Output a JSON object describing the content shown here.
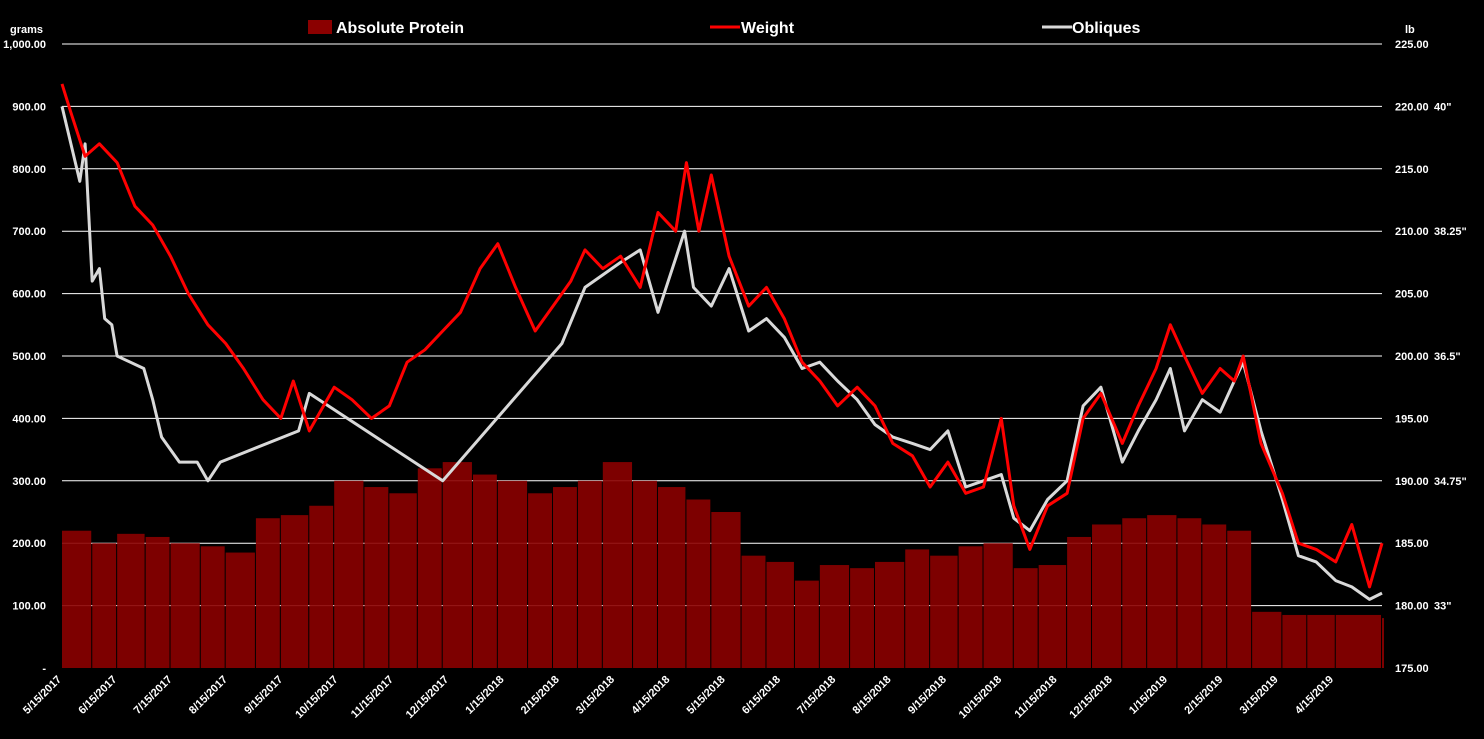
{
  "chart_data": {
    "type": "bar",
    "left_axis_unit": "grams",
    "right_axis_unit": "lb",
    "left_ticks": [
      "-",
      "100.00",
      "200.00",
      "300.00",
      "400.00",
      "500.00",
      "600.00",
      "700.00",
      "800.00",
      "900.00",
      "1,000.00"
    ],
    "right_ticks": [
      "175.00",
      "180.00",
      "185.00",
      "190.00",
      "195.00",
      "200.00",
      "205.00",
      "210.00",
      "215.00",
      "220.00",
      "225.00"
    ],
    "inch_ticks": [
      {
        "lb": 180,
        "label": "33\""
      },
      {
        "lb": 190,
        "label": "34.75\""
      },
      {
        "lb": 200,
        "label": "36.5\""
      },
      {
        "lb": 210,
        "label": "38.25\""
      },
      {
        "lb": 220,
        "label": "40\""
      }
    ],
    "ylim_left": [
      0,
      1000
    ],
    "ylim_right": [
      175,
      225
    ],
    "x_start": "2017-05-15",
    "x_end": "2019-05-27",
    "x_tick_labels": [
      "5/15/2017",
      "6/15/2017",
      "7/15/2017",
      "8/15/2017",
      "9/15/2017",
      "10/15/2017",
      "11/15/2017",
      "12/15/2017",
      "1/15/2018",
      "2/15/2018",
      "3/15/2018",
      "4/15/2018",
      "5/15/2018",
      "6/15/2018",
      "7/15/2018",
      "8/15/2018",
      "9/15/2018",
      "10/15/2018",
      "11/15/2018",
      "12/15/2018",
      "1/15/2019",
      "2/15/2019",
      "3/15/2019",
      "4/15/2019"
    ],
    "grid": true,
    "legend_position": "top",
    "series": [
      {
        "name": "Absolute Protein",
        "kind": "bar",
        "axis": "left",
        "color": "#8b0000",
        "points": [
          [
            "2017-05-15",
            220
          ],
          [
            "2017-06-01",
            200
          ],
          [
            "2017-06-15",
            215
          ],
          [
            "2017-07-01",
            210
          ],
          [
            "2017-07-15",
            200
          ],
          [
            "2017-08-01",
            195
          ],
          [
            "2017-08-15",
            185
          ],
          [
            "2017-09-01",
            240
          ],
          [
            "2017-09-15",
            245
          ],
          [
            "2017-10-01",
            260
          ],
          [
            "2017-10-15",
            300
          ],
          [
            "2017-11-01",
            290
          ],
          [
            "2017-11-15",
            280
          ],
          [
            "2017-12-01",
            320
          ],
          [
            "2017-12-15",
            330
          ],
          [
            "2018-01-01",
            310
          ],
          [
            "2018-01-15",
            300
          ],
          [
            "2018-02-01",
            280
          ],
          [
            "2018-02-15",
            290
          ],
          [
            "2018-03-01",
            300
          ],
          [
            "2018-03-15",
            330
          ],
          [
            "2018-04-01",
            300
          ],
          [
            "2018-04-15",
            290
          ],
          [
            "2018-05-01",
            270
          ],
          [
            "2018-05-15",
            250
          ],
          [
            "2018-06-01",
            180
          ],
          [
            "2018-06-15",
            170
          ],
          [
            "2018-07-01",
            140
          ],
          [
            "2018-07-15",
            165
          ],
          [
            "2018-08-01",
            160
          ],
          [
            "2018-08-15",
            170
          ],
          [
            "2018-09-01",
            190
          ],
          [
            "2018-09-15",
            180
          ],
          [
            "2018-10-01",
            195
          ],
          [
            "2018-10-15",
            200
          ],
          [
            "2018-11-01",
            160
          ],
          [
            "2018-11-15",
            165
          ],
          [
            "2018-12-01",
            210
          ],
          [
            "2018-12-15",
            230
          ],
          [
            "2019-01-01",
            240
          ],
          [
            "2019-01-15",
            245
          ],
          [
            "2019-02-01",
            240
          ],
          [
            "2019-02-15",
            230
          ],
          [
            "2019-03-01",
            220
          ],
          [
            "2019-03-15",
            90
          ],
          [
            "2019-04-01",
            85
          ],
          [
            "2019-04-15",
            85
          ],
          [
            "2019-05-01",
            85
          ],
          [
            "2019-05-27",
            80
          ]
        ]
      },
      {
        "name": "Weight",
        "kind": "line",
        "axis": "right",
        "color": "#ff0000",
        "points": [
          [
            "2017-05-15",
            221.8
          ],
          [
            "2017-05-20",
            219.5
          ],
          [
            "2017-05-28",
            216.0
          ],
          [
            "2017-06-05",
            217.0
          ],
          [
            "2017-06-15",
            215.5
          ],
          [
            "2017-06-25",
            212.0
          ],
          [
            "2017-07-05",
            210.5
          ],
          [
            "2017-07-15",
            208.0
          ],
          [
            "2017-07-25",
            205.0
          ],
          [
            "2017-08-05",
            202.5
          ],
          [
            "2017-08-15",
            201.0
          ],
          [
            "2017-08-25",
            199.0
          ],
          [
            "2017-09-05",
            196.5
          ],
          [
            "2017-09-15",
            195.0
          ],
          [
            "2017-09-22",
            198.0
          ],
          [
            "2017-10-01",
            194.0
          ],
          [
            "2017-10-15",
            197.5
          ],
          [
            "2017-10-25",
            196.5
          ],
          [
            "2017-11-05",
            195.0
          ],
          [
            "2017-11-15",
            196.0
          ],
          [
            "2017-11-25",
            199.5
          ],
          [
            "2017-12-05",
            200.5
          ],
          [
            "2017-12-15",
            202.0
          ],
          [
            "2017-12-25",
            203.5
          ],
          [
            "2018-01-05",
            207.0
          ],
          [
            "2018-01-15",
            209.0
          ],
          [
            "2018-01-25",
            205.5
          ],
          [
            "2018-02-05",
            202.0
          ],
          [
            "2018-02-15",
            204.0
          ],
          [
            "2018-02-25",
            206.0
          ],
          [
            "2018-03-05",
            208.5
          ],
          [
            "2018-03-15",
            207.0
          ],
          [
            "2018-03-25",
            208.0
          ],
          [
            "2018-04-05",
            205.5
          ],
          [
            "2018-04-15",
            211.5
          ],
          [
            "2018-04-25",
            210.0
          ],
          [
            "2018-05-01",
            215.5
          ],
          [
            "2018-05-08",
            210.0
          ],
          [
            "2018-05-15",
            214.5
          ],
          [
            "2018-05-25",
            208.0
          ],
          [
            "2018-06-05",
            204.0
          ],
          [
            "2018-06-15",
            205.5
          ],
          [
            "2018-06-25",
            203.0
          ],
          [
            "2018-07-05",
            199.5
          ],
          [
            "2018-07-15",
            198.0
          ],
          [
            "2018-07-25",
            196.0
          ],
          [
            "2018-08-05",
            197.5
          ],
          [
            "2018-08-15",
            196.0
          ],
          [
            "2018-08-25",
            193.0
          ],
          [
            "2018-09-05",
            192.0
          ],
          [
            "2018-09-15",
            189.5
          ],
          [
            "2018-09-25",
            191.5
          ],
          [
            "2018-10-05",
            189.0
          ],
          [
            "2018-10-15",
            189.5
          ],
          [
            "2018-10-25",
            195.0
          ],
          [
            "2018-11-01",
            188.0
          ],
          [
            "2018-11-10",
            184.5
          ],
          [
            "2018-11-20",
            188.0
          ],
          [
            "2018-12-01",
            189.0
          ],
          [
            "2018-12-10",
            195.0
          ],
          [
            "2018-12-20",
            197.0
          ],
          [
            "2019-01-01",
            193.0
          ],
          [
            "2019-01-10",
            196.0
          ],
          [
            "2019-01-20",
            199.0
          ],
          [
            "2019-01-28",
            202.5
          ],
          [
            "2019-02-05",
            200.0
          ],
          [
            "2019-02-15",
            197.0
          ],
          [
            "2019-02-25",
            199.0
          ],
          [
            "2019-03-05",
            198.0
          ],
          [
            "2019-03-10",
            200.0
          ],
          [
            "2019-03-20",
            193.0
          ],
          [
            "2019-04-01",
            189.0
          ],
          [
            "2019-04-10",
            185.0
          ],
          [
            "2019-04-20",
            184.5
          ],
          [
            "2019-05-01",
            183.5
          ],
          [
            "2019-05-10",
            186.5
          ],
          [
            "2019-05-20",
            181.5
          ],
          [
            "2019-05-27",
            185.0
          ]
        ]
      },
      {
        "name": "Obliques",
        "kind": "line",
        "axis": "right",
        "color": "#d9d9d9",
        "points": [
          [
            "2017-05-15",
            220.0
          ],
          [
            "2017-05-25",
            214.0
          ],
          [
            "2017-05-28",
            217.0
          ],
          [
            "2017-06-01",
            206.0
          ],
          [
            "2017-06-05",
            207.0
          ],
          [
            "2017-06-08",
            203.0
          ],
          [
            "2017-06-12",
            202.5
          ],
          [
            "2017-06-15",
            200.0
          ],
          [
            "2017-06-30",
            199.0
          ],
          [
            "2017-07-05",
            196.5
          ],
          [
            "2017-07-10",
            193.5
          ],
          [
            "2017-07-20",
            191.5
          ],
          [
            "2017-07-30",
            191.5
          ],
          [
            "2017-08-05",
            190.0
          ],
          [
            "2017-08-12",
            191.5
          ],
          [
            "2017-09-25",
            194.0
          ],
          [
            "2017-10-01",
            197.0
          ],
          [
            "2017-12-15",
            190.0
          ],
          [
            "2018-02-20",
            201.0
          ],
          [
            "2018-03-05",
            205.5
          ],
          [
            "2018-03-25",
            207.5
          ],
          [
            "2018-04-05",
            208.5
          ],
          [
            "2018-04-15",
            203.5
          ],
          [
            "2018-04-30",
            210.0
          ],
          [
            "2018-05-05",
            205.5
          ],
          [
            "2018-05-15",
            204.0
          ],
          [
            "2018-05-25",
            207.0
          ],
          [
            "2018-06-05",
            202.0
          ],
          [
            "2018-06-15",
            203.0
          ],
          [
            "2018-06-25",
            201.5
          ],
          [
            "2018-07-05",
            199.0
          ],
          [
            "2018-07-15",
            199.5
          ],
          [
            "2018-07-25",
            198.0
          ],
          [
            "2018-08-05",
            196.5
          ],
          [
            "2018-08-15",
            194.5
          ],
          [
            "2018-08-25",
            193.5
          ],
          [
            "2018-09-05",
            193.0
          ],
          [
            "2018-09-15",
            192.5
          ],
          [
            "2018-09-25",
            194.0
          ],
          [
            "2018-10-05",
            189.5
          ],
          [
            "2018-10-15",
            190.0
          ],
          [
            "2018-10-25",
            190.5
          ],
          [
            "2018-11-01",
            187.0
          ],
          [
            "2018-11-10",
            186.0
          ],
          [
            "2018-11-20",
            188.5
          ],
          [
            "2018-12-01",
            190.0
          ],
          [
            "2018-12-10",
            196.0
          ],
          [
            "2018-12-20",
            197.5
          ],
          [
            "2019-01-01",
            191.5
          ],
          [
            "2019-01-10",
            194.0
          ],
          [
            "2019-01-20",
            196.5
          ],
          [
            "2019-01-28",
            199.0
          ],
          [
            "2019-02-05",
            194.0
          ],
          [
            "2019-02-15",
            196.5
          ],
          [
            "2019-02-25",
            195.5
          ],
          [
            "2019-03-05",
            198.0
          ],
          [
            "2019-03-10",
            199.5
          ],
          [
            "2019-03-20",
            194.0
          ],
          [
            "2019-04-01",
            188.5
          ],
          [
            "2019-04-10",
            184.0
          ],
          [
            "2019-04-20",
            183.5
          ],
          [
            "2019-05-01",
            182.0
          ],
          [
            "2019-05-10",
            181.5
          ],
          [
            "2019-05-20",
            180.5
          ],
          [
            "2019-05-27",
            181.0
          ]
        ]
      }
    ]
  }
}
